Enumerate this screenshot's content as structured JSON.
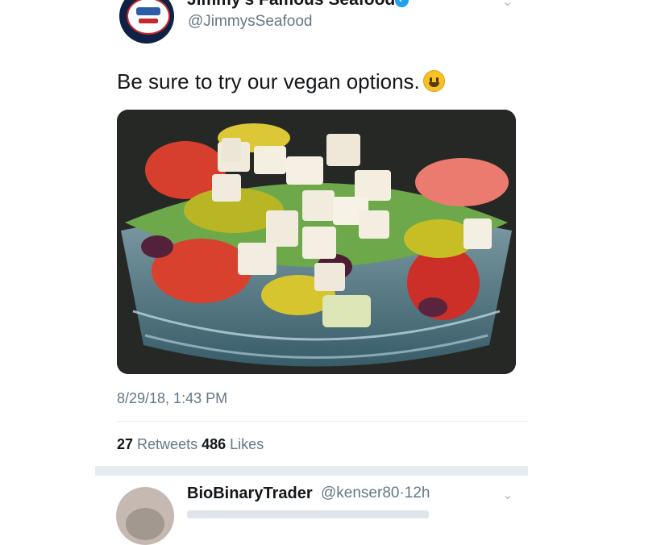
{
  "tweet": {
    "display_name": "Jimmy's Famous Seafood",
    "handle": "@JimmysSeafood",
    "text": "Be sure to try our vegan options.",
    "emoji_icon": "smiling-face-emoji",
    "image_subject": "greek-salad-photo",
    "timestamp": "8/29/18, 1:43 PM",
    "retweets_count": "27",
    "retweets_label": "Retweets",
    "likes_count": "486",
    "likes_label": "Likes"
  },
  "reply": {
    "display_name": "BioBinaryTrader",
    "handle": "@kenser80",
    "separator": "·",
    "time": "12h"
  },
  "colors": {
    "verified_blue": "#1da1f2",
    "muted_text": "#657786",
    "divider": "#e6ecf0"
  }
}
